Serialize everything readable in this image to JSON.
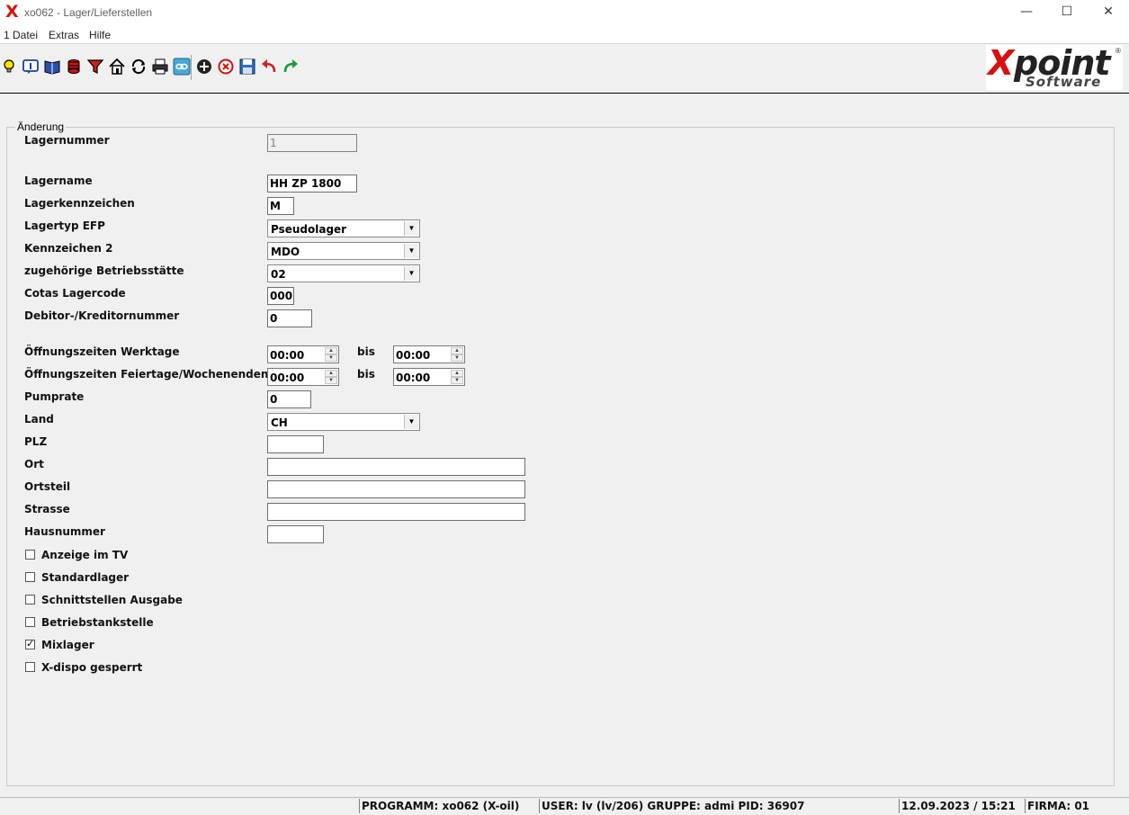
{
  "window": {
    "title": "xo062 - Lager/Lieferstellen",
    "app_glyph": "X",
    "minimize": "—",
    "maximize": "☐",
    "close": "✕"
  },
  "menu": [
    "1 Datei",
    "Extras",
    "Hilfe"
  ],
  "toolbar": [
    "lightbulb-icon",
    "info-icon",
    "book-icon",
    "database-icon",
    "filter-icon",
    "home-icon",
    "refresh-icon",
    "print-icon",
    "link-icon",
    "add-icon",
    "cancel-icon",
    "save-icon",
    "undo-icon",
    "redo-icon"
  ],
  "logo": {
    "x": "X",
    "point": "point",
    "software": "Software",
    "reg": "®"
  },
  "group_title": "Änderung",
  "labels": {
    "lagernummer": "Lagernummer",
    "lagername": "Lagername",
    "lagerkennzeichen": "Lagerkennzeichen",
    "lagertyp": "Lagertyp EFP",
    "kennzeichen2": "Kennzeichen 2",
    "betriebsstaette": "zugehörige Betriebsstätte",
    "cotas": "Cotas Lagercode",
    "debitor": "Debitor-/Kreditornummer",
    "oeff_werktage": "Öffnungszeiten Werktage",
    "oeff_feiertage": "Öffnungszeiten Feiertage/Wochenenden",
    "bis": "bis",
    "pumprate": "Pumprate",
    "land": "Land",
    "plz": "PLZ",
    "ort": "Ort",
    "ortsteil": "Ortsteil",
    "strasse": "Strasse",
    "hausnummer": "Hausnummer"
  },
  "values": {
    "lagernummer": "1",
    "lagername": "HH ZP 1800",
    "lagerkennzeichen": "M",
    "lagertyp": "Pseudolager",
    "kennzeichen2": "MDO",
    "betriebsstaette": "02",
    "cotas": "000",
    "debitor": "0",
    "werktage_von": "00:00",
    "werktage_bis": "00:00",
    "feiertage_von": "00:00",
    "feiertage_bis": "00:00",
    "pumprate": "0",
    "land": "CH",
    "plz": "",
    "ort": "",
    "ortsteil": "",
    "strasse": "",
    "hausnummer": ""
  },
  "checkboxes": [
    {
      "label": "Anzeige im TV",
      "checked": false
    },
    {
      "label": "Standardlager",
      "checked": false
    },
    {
      "label": "Schnittstellen Ausgabe",
      "checked": false
    },
    {
      "label": "Betriebstankstelle",
      "checked": false
    },
    {
      "label": "Mixlager",
      "checked": true
    },
    {
      "label": "X-dispo gesperrt",
      "checked": false
    }
  ],
  "glyphs": {
    "dropdown": "▼",
    "spin_up": "▲",
    "spin_down": "▼",
    "check": "✓"
  },
  "status": {
    "programm": "PROGRAMM: xo062 (X-oil)",
    "user": "USER: lv (lv/206)  GRUPPE: admi  PID: 36907",
    "datetime": "12.09.2023 / 15:21",
    "firma": "FIRMA: 01"
  }
}
